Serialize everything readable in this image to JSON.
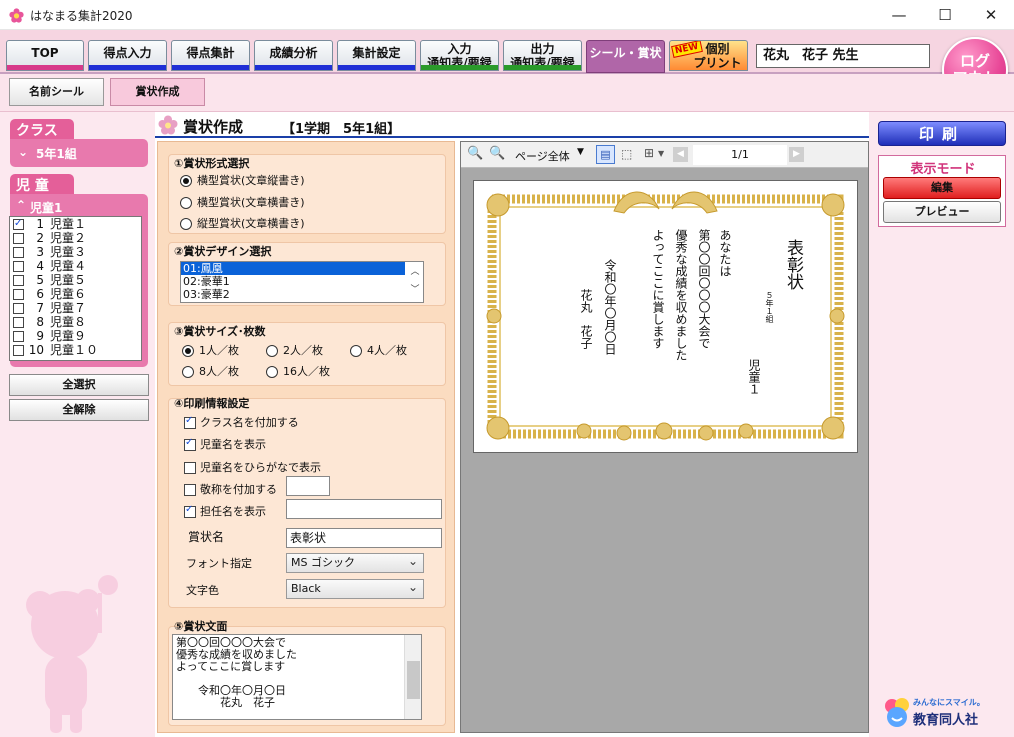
{
  "window": {
    "title": "はなまる集計2020",
    "minimize": "—",
    "maximize": "☐",
    "close": "✕"
  },
  "nav": {
    "tabs": [
      {
        "line1": "TOP",
        "line2": "",
        "bar": "#d73a8a"
      },
      {
        "line1": "得点入力",
        "line2": "",
        "bar": "#1f2fd6"
      },
      {
        "line1": "得点集計",
        "line2": "",
        "bar": "#1f2fd6"
      },
      {
        "line1": "成績分析",
        "line2": "",
        "bar": "#1f2fd6"
      },
      {
        "line1": "集計設定",
        "line2": "",
        "bar": "#1f2fd6"
      },
      {
        "line1": "入力",
        "line2": "通知表/要録",
        "bar": "#2a9a2a"
      },
      {
        "line1": "出力",
        "line2": "通知表/要録",
        "bar": "#2a9a2a"
      },
      {
        "line1": "シール・賞状",
        "line2": "",
        "bar": "#7f3e7a"
      },
      {
        "line1": "個別",
        "line2": "プリント",
        "bar": "#ff6a00",
        "badge": "NEW"
      }
    ],
    "teacher": "花丸　花子 先生",
    "logout_line1": "ログ",
    "logout_line2": "アウト"
  },
  "subnav": {
    "tabs": [
      "名前シール",
      "賞状作成"
    ]
  },
  "sidebar": {
    "class_header": "クラス",
    "class_value": "5年1組",
    "children_header": "児 童",
    "children_group": "児童1",
    "students": [
      {
        "num": "1",
        "name": "児童１",
        "checked": true
      },
      {
        "num": "2",
        "name": "児童２",
        "checked": false
      },
      {
        "num": "3",
        "name": "児童３",
        "checked": false
      },
      {
        "num": "4",
        "name": "児童４",
        "checked": false
      },
      {
        "num": "5",
        "name": "児童５",
        "checked": false
      },
      {
        "num": "6",
        "name": "児童６",
        "checked": false
      },
      {
        "num": "7",
        "name": "児童７",
        "checked": false
      },
      {
        "num": "8",
        "name": "児童８",
        "checked": false
      },
      {
        "num": "9",
        "name": "児童９",
        "checked": false
      },
      {
        "num": "10",
        "name": "児童１０",
        "checked": false
      }
    ],
    "select_all": "全選択",
    "deselect_all": "全解除"
  },
  "header": {
    "title": "賞状作成",
    "info": "【1学期　5年1組】"
  },
  "form": {
    "s1_title": "①賞状形式選択",
    "s1_options": [
      "横型賞状(文章縦書き)",
      "横型賞状(文章横書き)",
      "縦型賞状(文章横書き)"
    ],
    "s2_title": "②賞状デザイン選択",
    "s2_options": [
      "01:鳳凰",
      "02:豪華1",
      "03:豪華2"
    ],
    "s3_title": "③賞状サイズ･枚数",
    "s3_options": [
      "1人／枚",
      "2人／枚",
      "4人／枚",
      "8人／枚",
      "16人／枚"
    ],
    "s4_title": "④印刷情報設定",
    "opt_class": "クラス名を付加する",
    "opt_child": "児童名を表示",
    "opt_hiragana": "児童名をひらがなで表示",
    "opt_honorific": "敬称を付加する",
    "opt_teacher": "担任名を表示",
    "award_label": "賞状名",
    "award_value": "表彰状",
    "font_label": "フォント指定",
    "font_value": "MS ゴシック",
    "color_label": "文字色",
    "color_value": "Black",
    "s5_title": "⑤賞状文面",
    "body_text": "第〇〇回〇〇〇大会で\n優秀な成績を収めました\nよってここに賞します\n\n　　令和〇年〇月〇日\n　　　　花丸　花子"
  },
  "preview": {
    "zoom": "ページ全体",
    "page": "1/1",
    "award_title": "表彰状",
    "class_name": "５年１組",
    "child_name": "児童１",
    "body_lines": [
      "あなたは",
      "第〇〇回〇〇〇大会で",
      "優秀な成績を収めました",
      "よってここに賞します"
    ],
    "date": "令和〇年〇月〇日",
    "signer": "花丸　花子"
  },
  "right": {
    "print": "印刷",
    "mode_title": "表示モード",
    "edit": "編集",
    "preview": "プレビュー",
    "logo_tagline": "みんなにスマイル。",
    "logo_name": "教育同人社"
  },
  "colors": {
    "accent_pink": "#e45f99",
    "primary_blue": "#1f2fb8",
    "frame_gold": "#d8b24a"
  }
}
